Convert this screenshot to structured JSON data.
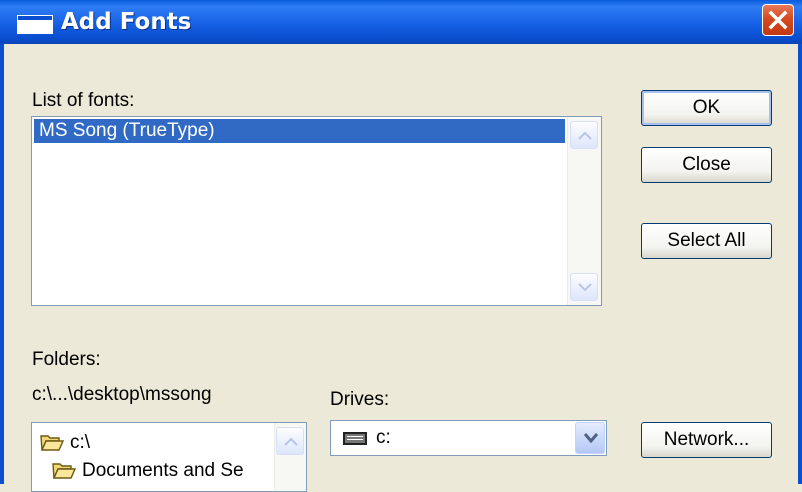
{
  "window": {
    "title": "Add Fonts"
  },
  "fonts_list": {
    "label": "List of fonts:",
    "items": [
      "MS Song (TrueType)"
    ],
    "selected": "MS Song (TrueType)"
  },
  "buttons": {
    "ok": "OK",
    "close": "Close",
    "select_all": "Select All",
    "network": "Network..."
  },
  "folders": {
    "label": "Folders:",
    "current_path": "c:\\...\\desktop\\mssong",
    "items": [
      "c:\\",
      "Documents and Se"
    ]
  },
  "drives": {
    "label": "Drives:",
    "selected": "c:"
  },
  "colors": {
    "titlebar": "#0a4fd0",
    "selection": "#316ac5",
    "dialog_bg": "#ece9d8",
    "close_button": "#d44a21"
  }
}
